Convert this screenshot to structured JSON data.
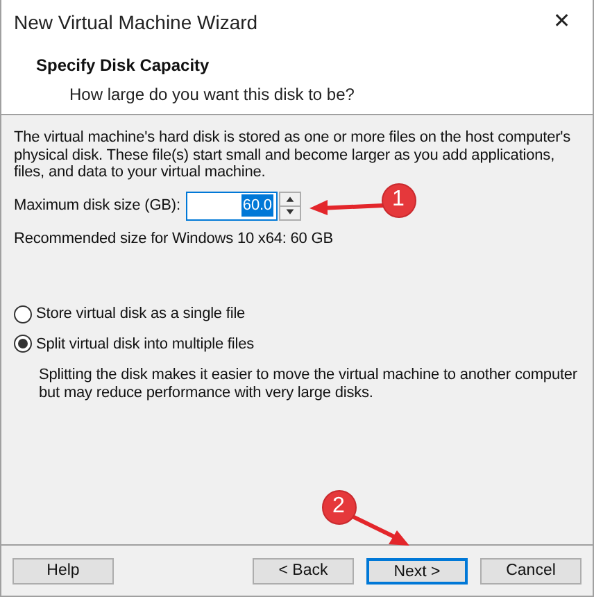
{
  "window": {
    "title": "New Virtual Machine Wizard",
    "close": "✕"
  },
  "header": {
    "title": "Specify Disk Capacity",
    "subtitle": "How large do you want this disk to be?"
  },
  "description": "The virtual machine's hard disk is stored as one or more files on the host computer's physical disk. These file(s) start small and become larger as you add applications, files, and data to your virtual machine.",
  "disk_size": {
    "label": "Maximum disk size (GB):",
    "value": "60.0",
    "text_selected": true
  },
  "recommendation": "Recommended size for Windows 10 x64: 60 GB",
  "options": [
    {
      "label": "Store virtual disk as a single file",
      "selected": false
    },
    {
      "label": "Split virtual disk into multiple files",
      "selected": true
    }
  ],
  "option_note": "Splitting the disk makes it easier to move the virtual machine to another computer but may reduce performance with very large disks.",
  "buttons": [
    {
      "label": "Help",
      "focused": false
    },
    {
      "label": "< Back",
      "focused": false
    },
    {
      "label": "Next >",
      "focused": true
    },
    {
      "label": "Cancel",
      "focused": false
    }
  ],
  "annotations": [
    {
      "label": "1"
    },
    {
      "label": "2"
    }
  ]
}
